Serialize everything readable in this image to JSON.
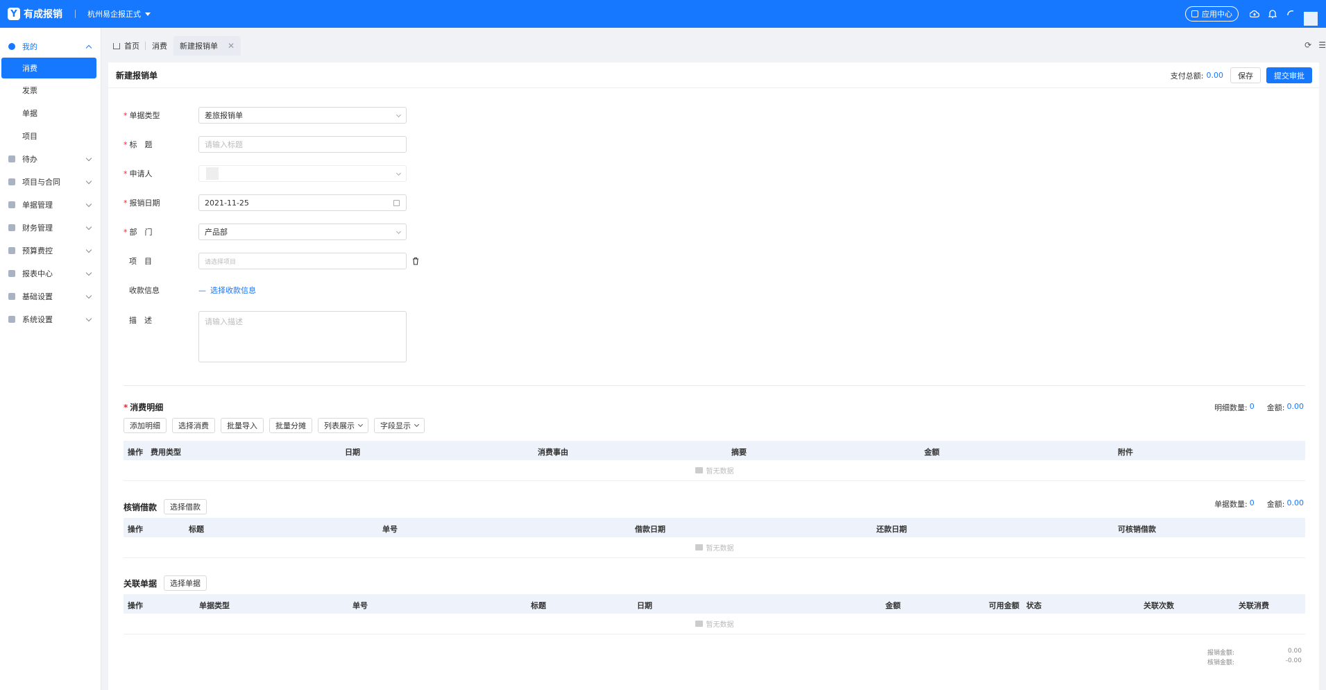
{
  "topbar": {
    "logo_glyph": "Y",
    "app_name": "有成报销",
    "company": "杭州易企报正式",
    "app_center": "应用中心"
  },
  "sidebar": {
    "groups": [
      {
        "label": "我的",
        "open": true,
        "items": [
          "消费",
          "发票",
          "单据",
          "项目"
        ]
      },
      {
        "label": "待办"
      },
      {
        "label": "项目与合同"
      },
      {
        "label": "单据管理"
      },
      {
        "label": "财务管理"
      },
      {
        "label": "预算费控"
      },
      {
        "label": "报表中心"
      },
      {
        "label": "基础设置"
      },
      {
        "label": "系统设置"
      }
    ],
    "active_item": "消费"
  },
  "tabs": [
    "首页",
    "消费",
    "新建报销单"
  ],
  "page": {
    "title": "新建报销单",
    "pay_total_label": "支付总额:",
    "pay_total_value": "0.00",
    "save_label": "保存",
    "submit_label": "提交审批"
  },
  "form": {
    "doc_type": {
      "label": "单据类型",
      "value": "差旅报销单"
    },
    "title": {
      "label": "标　题",
      "placeholder": "请输入标题"
    },
    "applicant": {
      "label": "申请人"
    },
    "date": {
      "label": "报销日期",
      "value": "2021-11-25"
    },
    "dept": {
      "label": "部　门",
      "value": "产品部"
    },
    "project": {
      "label": "项　目",
      "placeholder": "请选择项目"
    },
    "payee": {
      "label": "收款信息",
      "link": "选择收款信息"
    },
    "desc": {
      "label": "描　述",
      "placeholder": "请输入描述"
    }
  },
  "consumption": {
    "title": "消费明细",
    "count_label": "明细数量:",
    "count": "0",
    "amount_label": "金额:",
    "amount": "0.00",
    "buttons": [
      "添加明细",
      "选择消费",
      "批量导入",
      "批量分摊",
      "列表展示",
      "字段显示"
    ],
    "columns": [
      "操作",
      "费用类型",
      "日期",
      "消费事由",
      "摘要",
      "金额",
      "附件"
    ],
    "empty": "暂无数据"
  },
  "loans": {
    "title": "核销借款",
    "button": "选择借款",
    "count_label": "单据数量:",
    "count": "0",
    "amount_label": "金额:",
    "amount": "0.00",
    "columns": [
      "操作",
      "标题",
      "单号",
      "借款日期",
      "还款日期",
      "可核销借款"
    ],
    "empty": "暂无数据"
  },
  "related": {
    "title": "关联单据",
    "button": "选择单据",
    "columns": [
      "操作",
      "单据类型",
      "单号",
      "标题",
      "日期",
      "金额",
      "可用金额",
      "状态",
      "关联次数",
      "关联消费"
    ],
    "empty": "暂无数据"
  },
  "totals": {
    "reimburse_label": "报销金额:",
    "reimburse_value": "0.00",
    "writeoff_label": "核销金额:",
    "writeoff_value": "-0.00"
  },
  "colors": {
    "primary": "#1677ff",
    "required": "#f5222d"
  }
}
